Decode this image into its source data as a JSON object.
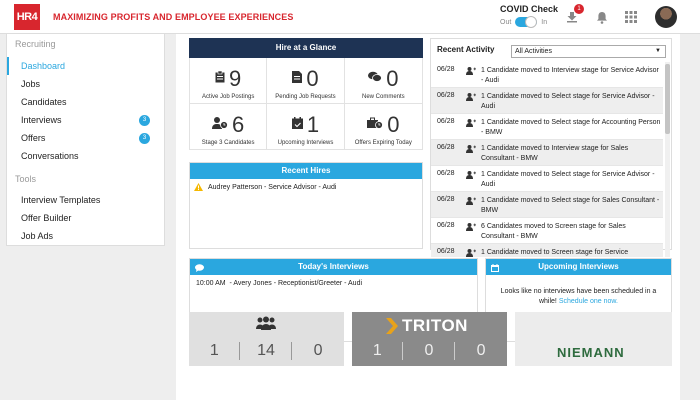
{
  "header": {
    "logo_text": "HR4",
    "tagline": "MAXIMIZING PROFITS AND EMPLOYEE EXPERIENCES",
    "covid_title": "COVID Check",
    "covid_off": "Out",
    "covid_on": "In",
    "notification_count": "1"
  },
  "sidebar": {
    "recruiting_label": "Recruiting",
    "tools_label": "Tools",
    "items": [
      {
        "label": "Dashboard"
      },
      {
        "label": "Jobs"
      },
      {
        "label": "Candidates"
      },
      {
        "label": "Interviews",
        "count": "3"
      },
      {
        "label": "Offers",
        "count": "3"
      },
      {
        "label": "Conversations"
      }
    ],
    "tools": [
      {
        "label": "Interview Templates"
      },
      {
        "label": "Offer Builder"
      },
      {
        "label": "Job Ads"
      }
    ]
  },
  "glance": {
    "title": "Hire at a Glance",
    "stats": [
      {
        "value": "9",
        "label": "Active Job Postings"
      },
      {
        "value": "0",
        "label": "Pending Job Requests"
      },
      {
        "value": "0",
        "label": "New Comments"
      },
      {
        "value": "6",
        "label": "Stage 3 Candidates"
      },
      {
        "value": "1",
        "label": "Upcoming Interviews"
      },
      {
        "value": "0",
        "label": "Offers Expiring Today"
      }
    ]
  },
  "recent_hires": {
    "title": "Recent Hires",
    "items": [
      "Audrey Patterson - Service Advisor - Audi"
    ]
  },
  "activity": {
    "title": "Recent Activity",
    "filter": "All Activities",
    "rows": [
      {
        "date": "06/28",
        "text": "1 Candidate moved to Interview stage for Service Advisor - Audi"
      },
      {
        "date": "06/28",
        "text": "1 Candidate moved to Select stage for Service Advisor - Audi"
      },
      {
        "date": "06/28",
        "text": "1 Candidate moved to Select stage for Accounting Person - BMW"
      },
      {
        "date": "06/28",
        "text": "1 Candidate moved to Interview stage for Sales Consultant - BMW"
      },
      {
        "date": "06/28",
        "text": "1 Candidate moved to Select stage for Service Advisor - Audi"
      },
      {
        "date": "06/28",
        "text": "1 Candidate moved to Select stage for Sales Consultant - BMW"
      },
      {
        "date": "06/28",
        "text": "6 Candidates moved to Screen stage for Sales Consultant - BMW"
      },
      {
        "date": "06/28",
        "text": "1 Candidate moved to Screen stage for Service"
      }
    ]
  },
  "todays_interviews": {
    "title": "Today's Interviews",
    "items": [
      {
        "time": "10:00 AM",
        "desc": "- Avery Jones - Receptionist/Greeter - Audi"
      }
    ]
  },
  "upcoming_interviews": {
    "title": "Upcoming Interviews",
    "message": "Looks like no interviews have been scheduled in a while!",
    "link": "Schedule one now."
  },
  "cards": [
    {
      "name": "",
      "nums": [
        "1",
        "14",
        "0"
      ]
    },
    {
      "name": "TRITON",
      "nums": [
        "1",
        "0",
        "0"
      ]
    },
    {
      "name": "NIEMANN",
      "nums": []
    }
  ],
  "colors": {
    "brand_red": "#d8262e",
    "accent_blue": "#2aa7df",
    "navy": "#1e3354"
  }
}
